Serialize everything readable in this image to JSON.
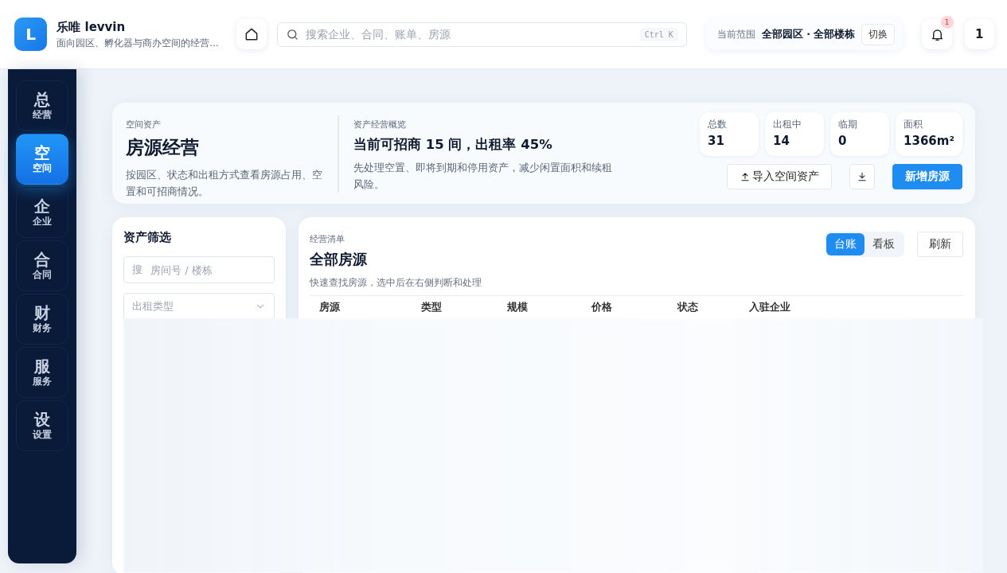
{
  "app": {
    "logo_letter": "L",
    "name": "乐唯 levvin",
    "tagline": "面向园区、孵化器与商办空间的经营…"
  },
  "search": {
    "placeholder": "搜索企业、合同、账单、房源",
    "shortcut": "Ctrl K"
  },
  "scope": {
    "label": "当前范围",
    "value": "全部园区 · 全部楼栋",
    "button": "切换"
  },
  "notifications": {
    "badge": "1"
  },
  "user": {
    "initial": "1"
  },
  "sidebar": {
    "items": [
      {
        "glyph": "总",
        "label": "经营",
        "selected": false
      },
      {
        "glyph": "空",
        "label": "空间",
        "selected": true
      },
      {
        "glyph": "企",
        "label": "企业",
        "selected": false
      },
      {
        "glyph": "合",
        "label": "合同",
        "selected": false
      },
      {
        "glyph": "财",
        "label": "财务",
        "selected": false
      },
      {
        "glyph": "服",
        "label": "服务",
        "selected": false
      },
      {
        "glyph": "设",
        "label": "设置",
        "selected": false
      }
    ]
  },
  "hero": {
    "eyebrow": "空间资产",
    "title": "房源经营",
    "description": "按园区、状态和出租方式查看房源占用、空置和可招商情况。",
    "overview": {
      "eyebrow": "资产经营概览",
      "headline": "当前可招商 15 间，出租率 45%",
      "description": "先处理空置、即将到期和停用资产，减少闲置面积和续租风险。"
    },
    "stats": [
      {
        "label": "总数",
        "value": "31"
      },
      {
        "label": "出租中",
        "value": "14"
      },
      {
        "label": "临期",
        "value": "0"
      },
      {
        "label": "面积",
        "value": "1366m²"
      }
    ],
    "actions": [
      {
        "kind": "upload",
        "label": "导入空间资产"
      },
      {
        "kind": "download"
      },
      {
        "kind": "primary",
        "label": "新增房源"
      }
    ]
  },
  "filter": {
    "title": "资产筛选",
    "search_prefix": "搜",
    "search_placeholder": "房间号 / 楼栋",
    "select_placeholder": "出租类型"
  },
  "list": {
    "eyebrow": "经营清单",
    "title": "全部房源",
    "subtitle": "快速查找房源，选中后在右侧判断和处理",
    "view_tabs": [
      {
        "label": "台账",
        "selected": true
      },
      {
        "label": "看板",
        "selected": false
      }
    ],
    "refresh": "刷新",
    "columns": [
      "房源",
      "类型",
      "规模",
      "价格",
      "状态",
      "入驻企业"
    ]
  }
}
